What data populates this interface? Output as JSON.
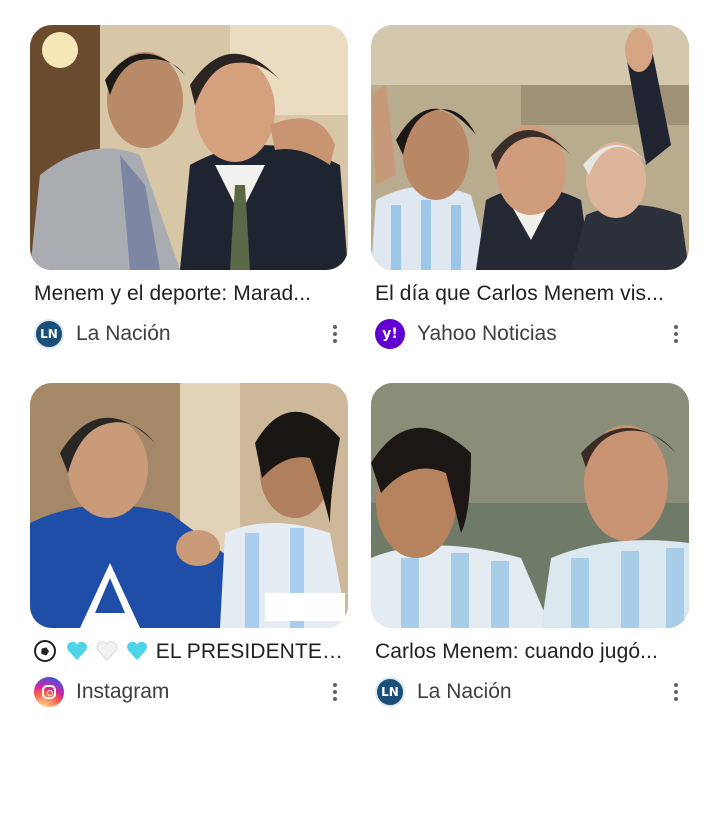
{
  "results": [
    {
      "title": "Menem y el deporte: Marad...",
      "source": "La Nación",
      "source_icon": "la-nacion-icon",
      "source_icon_text": "LN",
      "image_name": "maradona-menem-suits-image"
    },
    {
      "title": "El día que Carlos Menem vis...",
      "source": "Yahoo Noticias",
      "source_icon": "yahoo-icon",
      "source_icon_text": "y!",
      "image_name": "balcony-celebration-image"
    },
    {
      "title_text": "EL PRESIDENTE J...",
      "title_emoji": [
        "soccer-ball",
        "light-blue-heart",
        "white-heart",
        "light-blue-heart"
      ],
      "source": "Instagram",
      "source_icon": "instagram-icon",
      "image_name": "menem-blue-jersey-image"
    },
    {
      "title": "Carlos Menem: cuando jugó...",
      "source": "La Nación",
      "source_icon": "la-nacion-icon",
      "source_icon_text": "LN",
      "image_name": "argentina-jerseys-image"
    }
  ],
  "colors": {
    "text": "#202124",
    "secondary_text": "#3c4043",
    "more_icon": "#5f6368",
    "la_nacion": "#1b4f7a",
    "yahoo": "#6001d2",
    "light_blue_heart": "#4fd3e6"
  },
  "more_icon_name": "more-vert-icon"
}
